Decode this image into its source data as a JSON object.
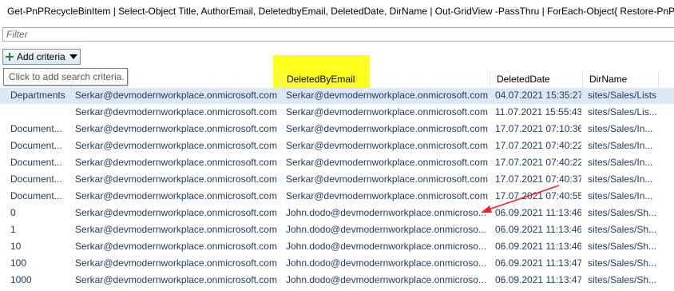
{
  "window": {
    "title": "Get-PnPRecycleBinItem | Select-Object Title, AuthorEmail, DeletedbyEmail, DeletedDate, DirName | Out-GridView -PassThru | ForEach-Object{ Restore-PnPRecycleBinItem"
  },
  "filter": {
    "placeholder": "Filter"
  },
  "criteria": {
    "label": "Add criteria"
  },
  "tooltip": {
    "text": "Click to add search criteria."
  },
  "columns": [
    "",
    "",
    "DeletedByEmail",
    "DeletedDate",
    "DirName"
  ],
  "rows": [
    [
      "Departments",
      "Serkar@devmodernworkplace.onmicrosoft.com",
      "Serkar@devmodernworkplace.onmicrosoft.com",
      "04.07.2021 15:35:27",
      "sites/Sales/Lists"
    ],
    [
      "",
      "Serkar@devmodernworkplace.onmicrosoft.com",
      "Serkar@devmodernworkplace.onmicrosoft.com",
      "11.07.2021 15:55:43",
      "sites/Sales/Lis..."
    ],
    [
      "Document...",
      "Serkar@devmodernworkplace.onmicrosoft.com",
      "Serkar@devmodernworkplace.onmicrosoft.com",
      "17.07.2021 07:10:36",
      "sites/Sales/In..."
    ],
    [
      "Document...",
      "Serkar@devmodernworkplace.onmicrosoft.com",
      "Serkar@devmodernworkplace.onmicrosoft.com",
      "17.07.2021 07:40:22",
      "sites/Sales/In..."
    ],
    [
      "Document...",
      "Serkar@devmodernworkplace.onmicrosoft.com",
      "Serkar@devmodernworkplace.onmicrosoft.com",
      "17.07.2021 07:40:22",
      "sites/Sales/In..."
    ],
    [
      "Document...",
      "Serkar@devmodernworkplace.onmicrosoft.com",
      "Serkar@devmodernworkplace.onmicrosoft.com",
      "17.07.2021 07:40:37",
      "sites/Sales/In..."
    ],
    [
      "Document...",
      "Serkar@devmodernworkplace.onmicrosoft.com",
      "Serkar@devmodernworkplace.onmicrosoft.com",
      "17.07.2021 07:40:55",
      "sites/Sales/In..."
    ],
    [
      "0",
      "Serkar@devmodernworkplace.onmicrosoft.com",
      "John.dodo@devmodernworkplace.onmicroso...",
      "06.09.2021 11:13:46",
      "sites/Sales/Sh..."
    ],
    [
      "1",
      "Serkar@devmodernworkplace.onmicrosoft.com",
      "John.dodo@devmodernworkplace.onmicroso...",
      "06.09.2021 11:13:46",
      "sites/Sales/Sh..."
    ],
    [
      "10",
      "Serkar@devmodernworkplace.onmicrosoft.com",
      "John.dodo@devmodernworkplace.onmicroso...",
      "06.09.2021 11:13:46",
      "sites/Sales/Sh..."
    ],
    [
      "100",
      "Serkar@devmodernworkplace.onmicrosoft.com",
      "John.dodo@devmodernworkplace.onmicroso...",
      "06.09.2021 11:13:47",
      "sites/Sales/Sh..."
    ],
    [
      "1000",
      "Serkar@devmodernworkplace.onmicrosoft.com",
      "John.dodo@devmodernworkplace.onmicroso...",
      "06.09.2021 11:13:47",
      "sites/Sales/Sh..."
    ]
  ],
  "colors": {
    "highlight": "#ffff1e",
    "selected_row": "#dde8f5",
    "row_text": "#1e395b",
    "arrow": "#e8262c"
  }
}
